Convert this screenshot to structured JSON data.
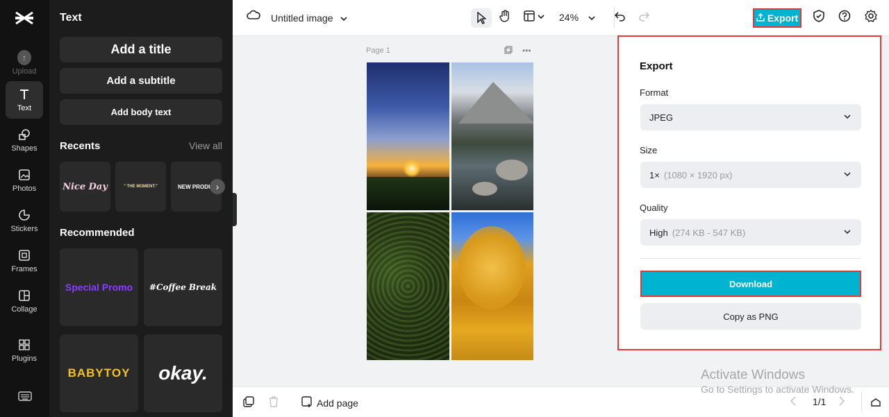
{
  "rail": {
    "items": [
      {
        "label": "Upload",
        "icon": "upload-icon"
      },
      {
        "label": "Text",
        "icon": "text-icon"
      },
      {
        "label": "Shapes",
        "icon": "shapes-icon"
      },
      {
        "label": "Photos",
        "icon": "photos-icon"
      },
      {
        "label": "Stickers",
        "icon": "stickers-icon"
      },
      {
        "label": "Frames",
        "icon": "frames-icon"
      },
      {
        "label": "Collage",
        "icon": "collage-icon"
      },
      {
        "label": "Plugins",
        "icon": "plugins-icon"
      }
    ]
  },
  "panel": {
    "title": "Text",
    "add_title": "Add a title",
    "add_subtitle": "Add a subtitle",
    "add_body": "Add body text",
    "recents_heading": "Recents",
    "view_all": "View all",
    "recents": [
      "Nice Day",
      "\" THE MOMENT.\"",
      "NEW PRODUC"
    ],
    "recommended_heading": "Recommended",
    "recommended": [
      "Special Promo",
      "#Coffee Break",
      "BABYTOY",
      "okay."
    ]
  },
  "topbar": {
    "doc_title": "Untitled image",
    "zoom": "24%",
    "export_label": "Export"
  },
  "canvas": {
    "page_label": "Page 1"
  },
  "export": {
    "heading": "Export",
    "format_label": "Format",
    "format_value": "JPEG",
    "size_label": "Size",
    "size_value": "1×",
    "size_detail": "(1080 × 1920 px)",
    "quality_label": "Quality",
    "quality_value": "High",
    "quality_detail": "(274 KB - 547 KB)",
    "download_label": "Download",
    "copy_label": "Copy as PNG"
  },
  "bottombar": {
    "add_page": "Add page",
    "page_count": "1/1"
  },
  "watermark": {
    "line1": "Activate Windows",
    "line2": "Go to Settings to activate Windows."
  },
  "colors": {
    "accent": "#00b3d0",
    "highlight_border": "#e53935",
    "rail_bg": "#121212",
    "panel_bg": "#1c1c1c"
  }
}
